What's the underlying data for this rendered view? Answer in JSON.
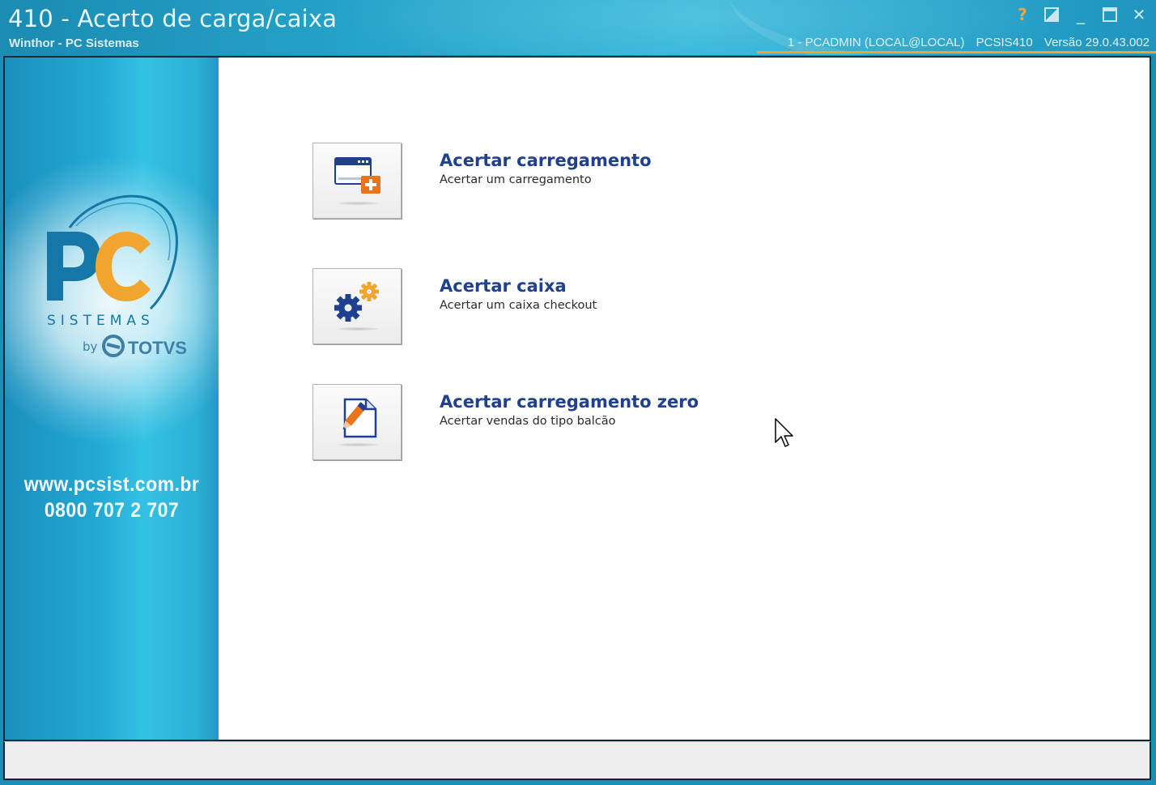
{
  "window": {
    "title": "410 - Acerto de carga/caixa",
    "subtitle": "Winthor - PC Sistemas",
    "user_info": "1 - PCADMIN (LOCAL@LOCAL)",
    "program": "PCSIS410",
    "version": "Versão 29.0.43.002",
    "controls": {
      "help": "?",
      "minimize": "_",
      "maximize": "❐",
      "close": "✕"
    }
  },
  "sidebar": {
    "logo": {
      "brand": "PC",
      "tagline": "SISTEMAS",
      "by": "by",
      "partner": "TOTVS"
    },
    "website": "www.pcsist.com.br",
    "phone": "0800 707 2 707"
  },
  "actions": [
    {
      "title": "Acertar carregamento",
      "description": "Acertar um carregamento",
      "icon": "window-add-icon"
    },
    {
      "title": "Acertar caixa",
      "description": "Acertar um caixa checkout",
      "icon": "gears-icon"
    },
    {
      "title": "Acertar carregamento zero",
      "description": "Acertar vendas do tipo balcão",
      "icon": "document-edit-icon"
    }
  ],
  "colors": {
    "accent": "#1f3f8f",
    "orange": "#f2a52e",
    "titlebar": "#27a6cc"
  }
}
